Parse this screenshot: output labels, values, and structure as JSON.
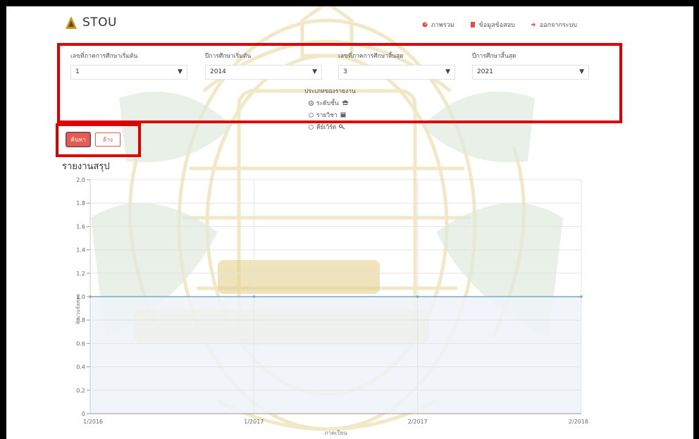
{
  "brand": {
    "name": "STOU"
  },
  "nav": {
    "items": [
      {
        "label": "ภาพรวม",
        "icon": "dashboard-icon",
        "color": "#e74c3c"
      },
      {
        "label": "ข้อมูลข้อสอบ",
        "icon": "document-icon",
        "color": "#e74c3c"
      },
      {
        "label": "ออกจากระบบ",
        "icon": "sign-out-icon",
        "color": "#e74c3c"
      }
    ]
  },
  "filters": {
    "start_semester": {
      "label": "เลขที่ภาคการศึกษาเริ่มต้น",
      "value": "1"
    },
    "start_year": {
      "label": "ปีการศึกษาเริ่มต้น",
      "value": "2014"
    },
    "end_semester": {
      "label": "เลขที่ภาคการศึกษาสิ้นสุด",
      "value": "3"
    },
    "end_year": {
      "label": "ปีการศึกษาสิ้นสุด",
      "value": "2021"
    }
  },
  "report_type": {
    "label": "ประเภทของรายงาน",
    "options": [
      {
        "label": "ระดับชั้น",
        "selected": true
      },
      {
        "label": "รายวิชา",
        "selected": false
      },
      {
        "label": "คีย์เวิร์ด",
        "selected": false
      }
    ]
  },
  "buttons": {
    "search": "ค้นหา",
    "clear": "ล้าง"
  },
  "summary": {
    "title": "รายงานสรุป"
  },
  "colors": {
    "accent": "#e85b51",
    "highlight": "#e00000",
    "line": "#7ba7c9",
    "area": "#eef3f8",
    "watermark": "#e8d79a"
  },
  "chart_data": {
    "type": "line",
    "categories": [
      "1/2016",
      "1/2017",
      "2/2017",
      "2/2018"
    ],
    "series": [
      {
        "values": [
          1.0,
          1.0,
          1.0,
          1.0
        ]
      }
    ],
    "yticks": [
      "0",
      "0.2",
      "0.4",
      "0.6",
      "0.8",
      "1.0",
      "1.2",
      "1.4",
      "1.6",
      "1.8",
      "2.0"
    ],
    "ylim": [
      0,
      2.0
    ],
    "xlabel": "ภาคเรียน",
    "ylabel": "จำนวนข้อสอบ",
    "grid": true
  }
}
